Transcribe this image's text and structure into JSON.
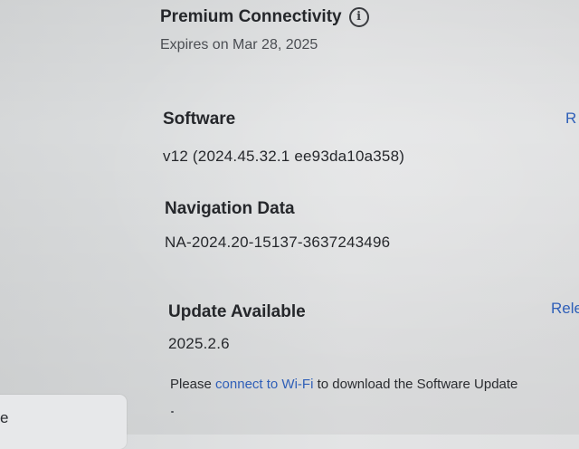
{
  "premium": {
    "title": "Premium Connectivity",
    "expires": "Expires on Mar 28, 2025",
    "info_icon": "info-icon"
  },
  "software": {
    "title": "Software",
    "version": "v12 (2024.45.32.1 ee93da10a358)",
    "right_link_label": "R"
  },
  "navigation_data": {
    "title": "Navigation Data",
    "version": "NA-2024.20-15137-3637243496"
  },
  "update": {
    "title": "Update Available",
    "version": "2025.2.6",
    "right_link_label": "Rele"
  },
  "wifi_note": {
    "prefix": "Please ",
    "link": "connect to Wi-Fi",
    "suffix": " to download the Software Update"
  },
  "sidebar_card": {
    "label": "e"
  },
  "colors": {
    "link": "#2f5fb8",
    "text": "#25272b",
    "background": "#dcdedf"
  }
}
